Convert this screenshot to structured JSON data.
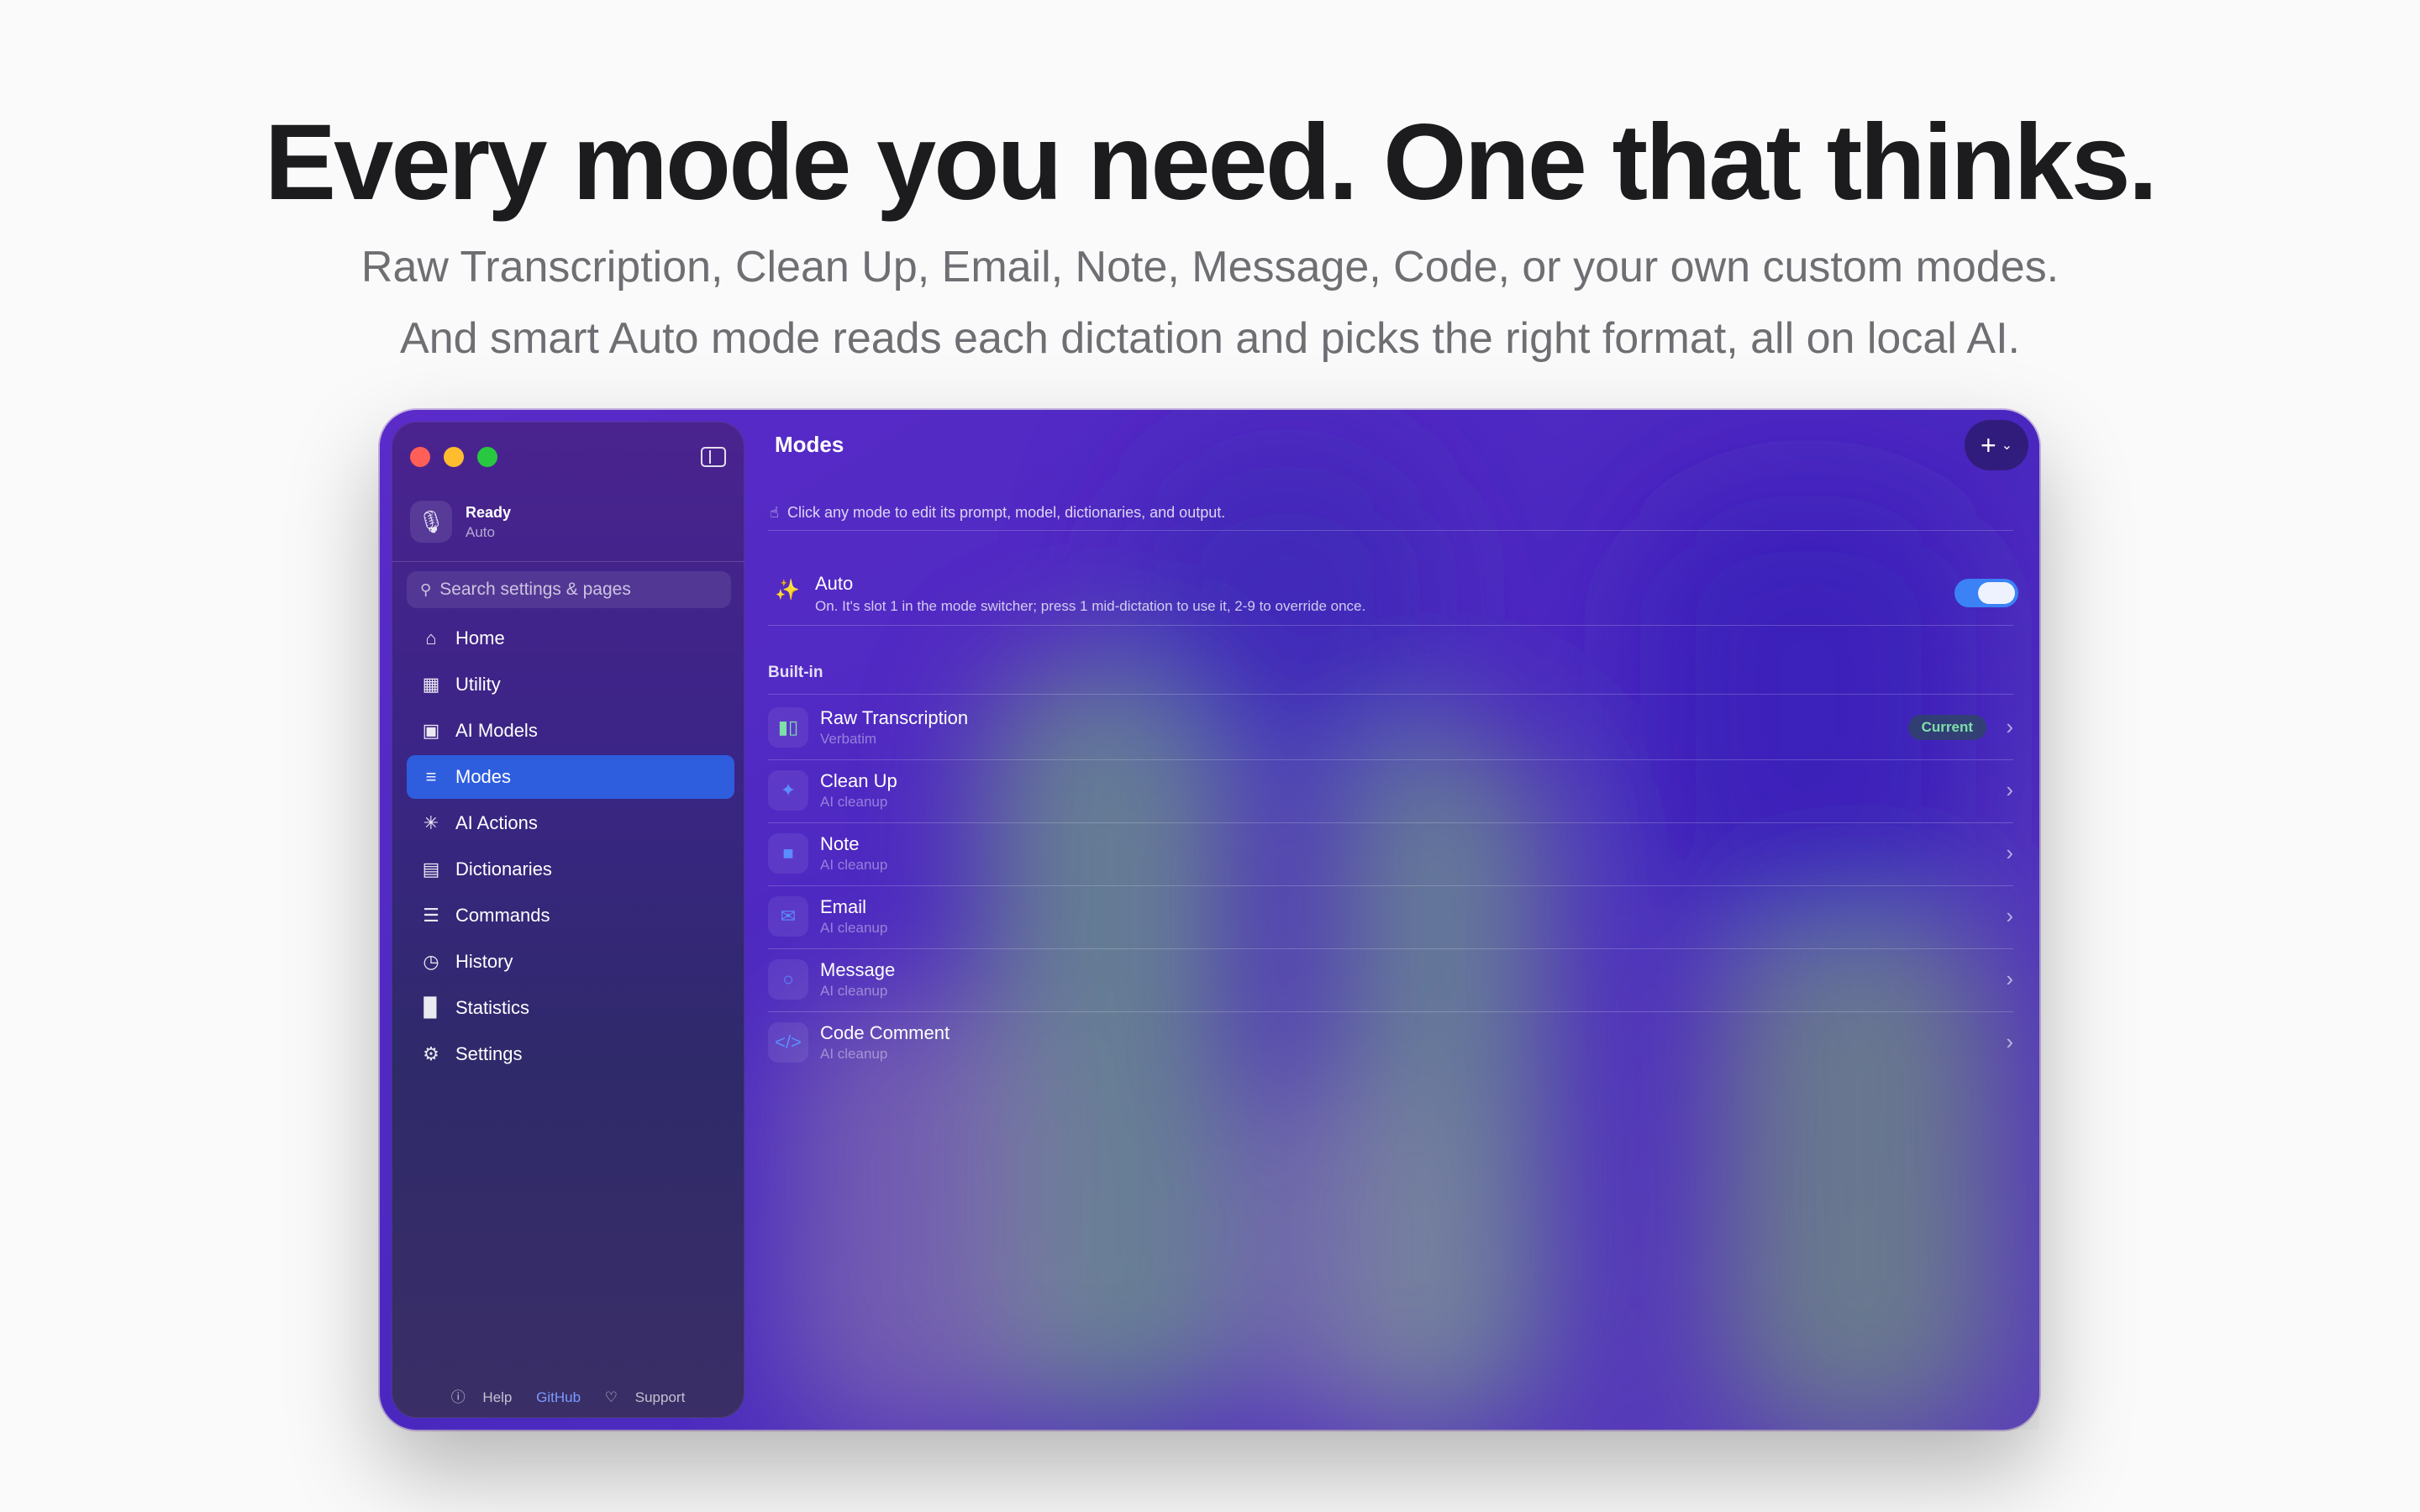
{
  "hero": {
    "title": "Every mode you need. One that thinks.",
    "subtitle_line1": "Raw Transcription, Clean Up, Email, Note, Message, Code, or your own custom modes.",
    "subtitle_line2": "And smart Auto mode reads each dictation and picks the right format, all on local AI."
  },
  "sidebar": {
    "status": {
      "main": "Ready",
      "sub": "Auto",
      "icon": "microphone-icon"
    },
    "search_placeholder": "Search settings & pages",
    "items": [
      {
        "label": "Home",
        "icon": "house-icon"
      },
      {
        "label": "Utility",
        "icon": "grid-icon"
      },
      {
        "label": "AI Models",
        "icon": "chip-icon"
      },
      {
        "label": "Modes",
        "icon": "sliders-icon",
        "active": true
      },
      {
        "label": "AI Actions",
        "icon": "sparkle-icon"
      },
      {
        "label": "Dictionaries",
        "icon": "book-icon"
      },
      {
        "label": "Commands",
        "icon": "list-icon"
      },
      {
        "label": "History",
        "icon": "clock-icon"
      },
      {
        "label": "Statistics",
        "icon": "bar-chart-icon"
      },
      {
        "label": "Settings",
        "icon": "gear-icon"
      }
    ],
    "footer": {
      "help": "Help",
      "github": "GitHub",
      "support": "Support"
    }
  },
  "main": {
    "title": "Modes",
    "hint": "Click any mode to edit its prompt, model, dictionaries, and output.",
    "auto": {
      "title": "Auto",
      "description": "On. It's slot 1 in the mode switcher; press 1 mid-dictation to use it, 2-9 to override once.",
      "enabled": true
    },
    "section_label": "Built-in",
    "modes": [
      {
        "name": "Raw Transcription",
        "sub": "Verbatim",
        "badge": "Current",
        "icon": "waveform-icon"
      },
      {
        "name": "Clean Up",
        "sub": "AI cleanup",
        "icon": "sparkle-icon"
      },
      {
        "name": "Note",
        "sub": "AI cleanup",
        "icon": "note-icon"
      },
      {
        "name": "Email",
        "sub": "AI cleanup",
        "icon": "envelope-icon"
      },
      {
        "name": "Message",
        "sub": "AI cleanup",
        "icon": "chat-bubble-icon"
      },
      {
        "name": "Code Comment",
        "sub": "AI cleanup",
        "icon": "code-icon"
      }
    ]
  },
  "colors": {
    "accent": "#2e5dde",
    "toggle_on": "#3b82f6",
    "current_badge_text": "#7ee0a8"
  }
}
